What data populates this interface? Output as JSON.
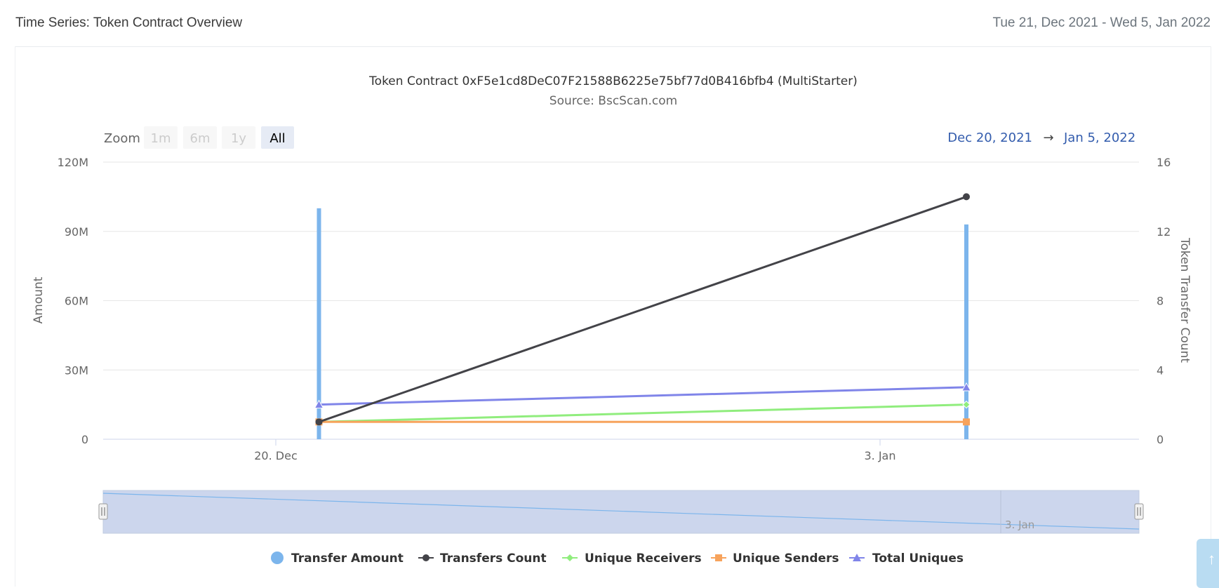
{
  "card": {
    "title": "Time Series: Token Contract Overview",
    "date_range": "Tue 21, Dec 2021 - Wed 5, Jan 2022"
  },
  "rangeSelector": {
    "zoom_label": "Zoom",
    "buttons": [
      "1m",
      "6m",
      "1y",
      "All"
    ],
    "selected": "All",
    "from": "Dec 20, 2021",
    "arrow": "→",
    "to": "Jan 5, 2022"
  },
  "navigator": {
    "tick_label": "3. Jan"
  },
  "colors": {
    "transfer_amount": "#7cb5ec",
    "transfers_count": "#434348",
    "unique_receivers": "#90ed7d",
    "unique_senders": "#f7a35c",
    "total_uniques": "#8085e9"
  },
  "chart_data": {
    "type": "line",
    "title": "Token Contract 0xF5e1cd8DeC07F21588B6225e75bf77d0B416bfb4 (MultiStarter)",
    "subtitle": "Source: BscScan.com",
    "xlabel": "",
    "ylabel": "Amount",
    "ylabel_right": "Token Transfer Count",
    "x_ticks": [
      "20. Dec",
      "3. Jan"
    ],
    "x_tick_dates": [
      "2021-12-20",
      "2022-01-03"
    ],
    "xlim": [
      "2021-12-16",
      "2022-01-09"
    ],
    "y_left": {
      "ticks": [
        "0",
        "30M",
        "60M",
        "90M",
        "120M"
      ],
      "ylim": [
        0,
        120000000
      ]
    },
    "y_right": {
      "ticks": [
        "0",
        "4",
        "8",
        "12",
        "16"
      ],
      "ylim": [
        0,
        16
      ]
    },
    "x": [
      "2021-12-21",
      "2022-01-05"
    ],
    "series": [
      {
        "name": "Transfer Amount",
        "type": "column",
        "axis": "left",
        "values": [
          100000000,
          93000000
        ]
      },
      {
        "name": "Transfers Count",
        "type": "line",
        "axis": "right",
        "marker": "circle",
        "values": [
          1,
          14
        ]
      },
      {
        "name": "Unique Receivers",
        "type": "line",
        "axis": "right",
        "marker": "diamond",
        "values": [
          1,
          2
        ]
      },
      {
        "name": "Unique Senders",
        "type": "line",
        "axis": "right",
        "marker": "square",
        "values": [
          1,
          1
        ]
      },
      {
        "name": "Total Uniques",
        "type": "line",
        "axis": "right",
        "marker": "triangle",
        "values": [
          2,
          3
        ]
      }
    ],
    "grid": true,
    "legend": "bottom-center"
  }
}
